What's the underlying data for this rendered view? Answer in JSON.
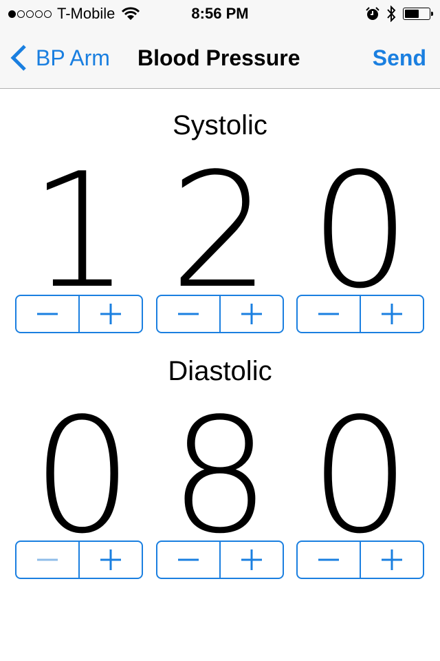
{
  "status_bar": {
    "signal_bars_filled": 1,
    "signal_bars_total": 5,
    "carrier": "T-Mobile",
    "time": "8:56 PM",
    "icons": [
      "wifi-icon",
      "alarm-icon",
      "bluetooth-icon",
      "battery-icon"
    ],
    "battery_level_percent": 60
  },
  "nav": {
    "back_label": "BP Arm",
    "title": "Blood Pressure",
    "send_label": "Send"
  },
  "colors": {
    "accent": "#1a7fe0",
    "disabled": "#8fbde9",
    "navbar_bg": "#f7f7f7"
  },
  "systolic": {
    "label": "Systolic",
    "value": 120,
    "digits": [
      "1",
      "2",
      "0"
    ],
    "steppers": [
      {
        "minus_enabled": true,
        "plus_enabled": true
      },
      {
        "minus_enabled": true,
        "plus_enabled": true
      },
      {
        "minus_enabled": true,
        "plus_enabled": true
      }
    ]
  },
  "diastolic": {
    "label": "Diastolic",
    "value": 80,
    "digits": [
      "0",
      "8",
      "0"
    ],
    "steppers": [
      {
        "minus_enabled": false,
        "plus_enabled": true
      },
      {
        "minus_enabled": true,
        "plus_enabled": true
      },
      {
        "minus_enabled": true,
        "plus_enabled": true
      }
    ]
  }
}
